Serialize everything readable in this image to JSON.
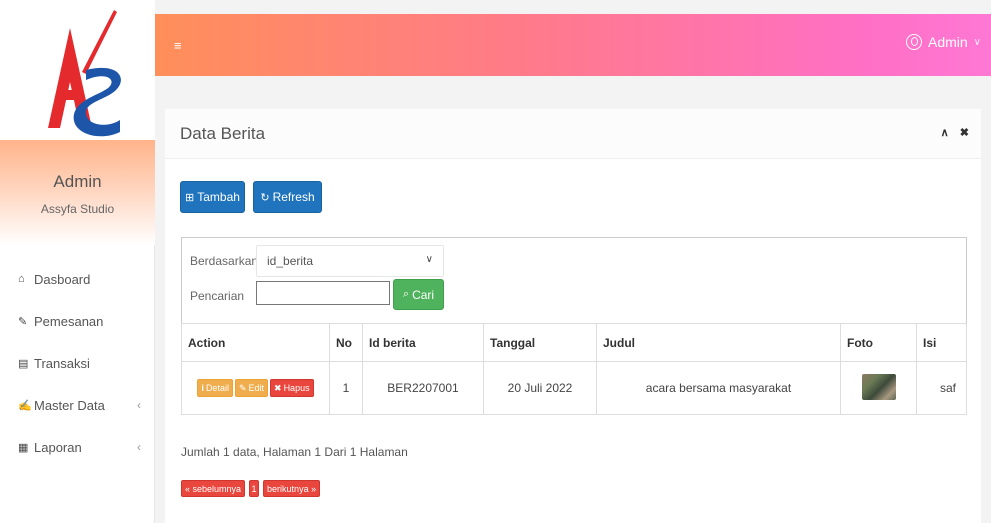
{
  "sidebar": {
    "logo_text": "AS",
    "profile_name": "Admin",
    "profile_sub": "Assyfa Studio",
    "items": [
      {
        "label": "Dasboard",
        "icon": "home-icon",
        "glyph": "⌂",
        "has_sub": false
      },
      {
        "label": "Pemesanan",
        "icon": "pencil-icon",
        "glyph": "✎",
        "has_sub": false
      },
      {
        "label": "Transaksi",
        "icon": "book-icon",
        "glyph": "▤",
        "has_sub": false
      },
      {
        "label": "Master Data",
        "icon": "edit-icon",
        "glyph": "✍",
        "has_sub": true
      },
      {
        "label": "Laporan",
        "icon": "calendar-icon",
        "glyph": "▦",
        "has_sub": true
      }
    ],
    "chevron": "‹"
  },
  "topbar": {
    "menu_glyph": "≡",
    "user_label": "Admin",
    "dropdown_glyph": "∨"
  },
  "panel": {
    "title": "Data Berita",
    "collapse_glyph": "∧",
    "close_glyph": "✖"
  },
  "buttons": {
    "tambah": "Tambah",
    "refresh": "Refresh",
    "cari": "Cari"
  },
  "filter": {
    "berdasarkan_label": "Berdasarkan:",
    "selected": "id_berita",
    "pencarian_label": "Pencarian",
    "separator": ":",
    "search_value": ""
  },
  "table": {
    "headers": [
      "Action",
      "No",
      "Id berita",
      "Tanggal",
      "Judul",
      "Foto",
      "Isi"
    ],
    "rows": [
      {
        "no": "1",
        "id": "BER2207001",
        "tanggal": "20 Juli 2022",
        "judul": "acara bersama masyarakat",
        "isi": "saf"
      }
    ],
    "actions": {
      "detail": "Detail",
      "edit": "Edit",
      "hapus": "Hapus"
    }
  },
  "footer": {
    "info": "Jumlah 1 data, Halaman 1 Dari 1 Halaman",
    "prev": "« sebelumnya",
    "page": "1",
    "next": "berikutnya »"
  },
  "colors": {
    "accent_blue": "#1f74bd",
    "accent_green": "#4fb25c",
    "accent_red": "#e9463e",
    "accent_orange": "#f0ad4e",
    "topbar_start": "#ff8f5a",
    "topbar_end": "#ff78d4"
  }
}
